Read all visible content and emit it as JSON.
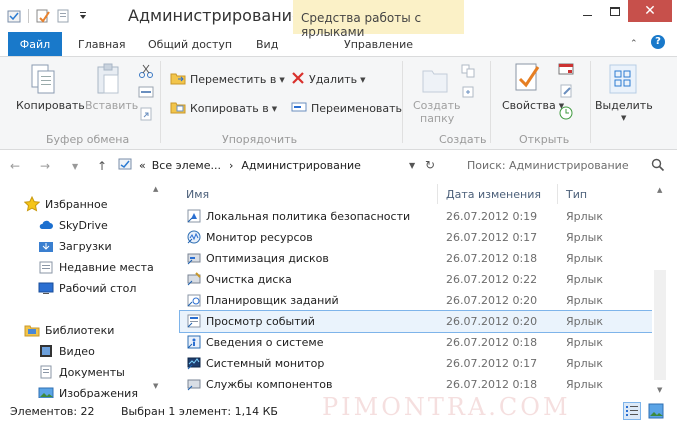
{
  "window": {
    "title": "Администрирование",
    "context_tab": "Средства работы с ярлыками",
    "close_glyph": "✕"
  },
  "tabs": {
    "file": "Файл",
    "home": "Главная",
    "share": "Общий доступ",
    "view": "Вид",
    "manage": "Управление",
    "help": "?"
  },
  "ribbon": {
    "clipboard": {
      "copy": "Копировать",
      "paste": "Вставить",
      "label": "Буфер обмена"
    },
    "organize": {
      "move_to": "Переместить в",
      "copy_to": "Копировать в",
      "delete": "Удалить",
      "rename": "Переименовать",
      "label": "Упорядочить"
    },
    "create": {
      "new_folder_1": "Создать",
      "new_folder_2": "папку",
      "label": "Создать"
    },
    "open": {
      "properties": "Свойства",
      "label": "Открыть"
    },
    "select": {
      "select": "Выделить"
    }
  },
  "address": {
    "prefix": "«",
    "crumb_1": "Все элеме...",
    "separator": "›",
    "crumb_2": "Администрирование",
    "search_placeholder": "Поиск: Администрирование"
  },
  "navpane": {
    "items": [
      {
        "label": "Избранное"
      },
      {
        "label": "SkyDrive"
      },
      {
        "label": "Загрузки"
      },
      {
        "label": "Недавние места"
      },
      {
        "label": "Рабочий стол"
      },
      {
        "label": "Библиотеки"
      },
      {
        "label": "Видео"
      },
      {
        "label": "Документы"
      },
      {
        "label": "Изображения"
      }
    ]
  },
  "filelist": {
    "columns": {
      "name": "Имя",
      "date": "Дата изменения",
      "type": "Тип"
    },
    "rows": [
      {
        "name": "Локальная политика безопасности",
        "date": "26.07.2012 0:19",
        "type": "Ярлык"
      },
      {
        "name": "Монитор ресурсов",
        "date": "26.07.2012 0:17",
        "type": "Ярлык"
      },
      {
        "name": "Оптимизация дисков",
        "date": "26.07.2012 0:18",
        "type": "Ярлык"
      },
      {
        "name": "Очистка диска",
        "date": "26.07.2012 0:22",
        "type": "Ярлык"
      },
      {
        "name": "Планировщик заданий",
        "date": "26.07.2012 0:20",
        "type": "Ярлык"
      },
      {
        "name": "Просмотр событий",
        "date": "26.07.2012 0:20",
        "type": "Ярлык"
      },
      {
        "name": "Сведения о системе",
        "date": "26.07.2012 0:18",
        "type": "Ярлык"
      },
      {
        "name": "Системный монитор",
        "date": "26.07.2012 0:17",
        "type": "Ярлык"
      },
      {
        "name": "Службы компонентов",
        "date": "26.07.2012 0:18",
        "type": "Ярлык"
      }
    ]
  },
  "status": {
    "items_count": "Элементов: 22",
    "selected": "Выбран 1 элемент: 1,14 КБ"
  },
  "watermark": "PIMONTRA.COM",
  "colors": {
    "accent": "#1979ca",
    "context_tab_bg": "#fbf1c7",
    "close_button": "#c7504b",
    "selection_border": "#7eb4ea"
  }
}
